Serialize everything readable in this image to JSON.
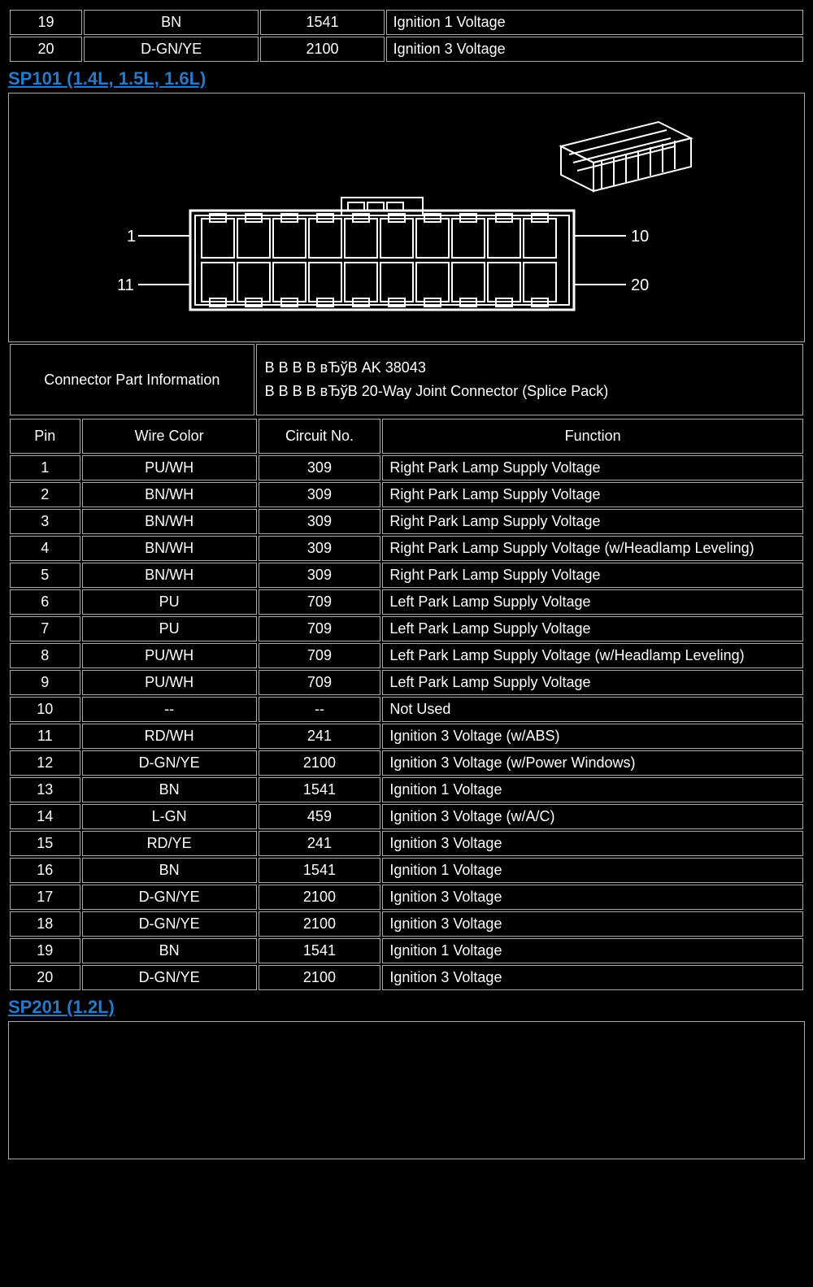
{
  "topRows": [
    {
      "pin": "19",
      "wire": "BN",
      "circ": "1541",
      "func": "Ignition 1 Voltage"
    },
    {
      "pin": "20",
      "wire": "D-GN/YE",
      "circ": "2100",
      "func": "Ignition 3 Voltage"
    }
  ],
  "heading1": "SP101 (1.4L, 1.5L, 1.6L)",
  "diagram": {
    "tl": "1",
    "tr": "10",
    "bl": "11",
    "br": "20"
  },
  "connInfo": {
    "label": "Connector Part Information",
    "line1": "В В В В вЂўВ  AK 38043",
    "line2": "В В В В вЂўВ  20-Way Joint Connector (Splice Pack)"
  },
  "headers": {
    "pin": "Pin",
    "wire": "Wire Color",
    "circ": "Circuit No.",
    "func": "Function"
  },
  "rows": [
    {
      "pin": "1",
      "wire": "PU/WH",
      "circ": "309",
      "func": "Right Park Lamp Supply Voltage"
    },
    {
      "pin": "2",
      "wire": "BN/WH",
      "circ": "309",
      "func": "Right Park Lamp Supply Voltage"
    },
    {
      "pin": "3",
      "wire": "BN/WH",
      "circ": "309",
      "func": "Right Park Lamp Supply Voltage"
    },
    {
      "pin": "4",
      "wire": "BN/WH",
      "circ": "309",
      "func": "Right Park Lamp Supply Voltage (w/Headlamp Leveling)"
    },
    {
      "pin": "5",
      "wire": "BN/WH",
      "circ": "309",
      "func": "Right Park Lamp Supply Voltage"
    },
    {
      "pin": "6",
      "wire": "PU",
      "circ": "709",
      "func": "Left Park Lamp Supply Voltage"
    },
    {
      "pin": "7",
      "wire": "PU",
      "circ": "709",
      "func": "Left Park Lamp Supply Voltage"
    },
    {
      "pin": "8",
      "wire": "PU/WH",
      "circ": "709",
      "func": "Left Park Lamp Supply Voltage (w/Headlamp Leveling)"
    },
    {
      "pin": "9",
      "wire": "PU/WH",
      "circ": "709",
      "func": "Left Park Lamp Supply Voltage"
    },
    {
      "pin": "10",
      "wire": "--",
      "circ": "--",
      "func": "Not Used"
    },
    {
      "pin": "11",
      "wire": "RD/WH",
      "circ": "241",
      "func": "Ignition 3 Voltage (w/ABS)"
    },
    {
      "pin": "12",
      "wire": "D-GN/YE",
      "circ": "2100",
      "func": "Ignition 3 Voltage (w/Power Windows)"
    },
    {
      "pin": "13",
      "wire": "BN",
      "circ": "1541",
      "func": "Ignition 1 Voltage"
    },
    {
      "pin": "14",
      "wire": "L-GN",
      "circ": "459",
      "func": "Ignition 3 Voltage (w/A/C)"
    },
    {
      "pin": "15",
      "wire": "RD/YE",
      "circ": "241",
      "func": "Ignition 3 Voltage"
    },
    {
      "pin": "16",
      "wire": "BN",
      "circ": "1541",
      "func": "Ignition 1 Voltage"
    },
    {
      "pin": "17",
      "wire": "D-GN/YE",
      "circ": "2100",
      "func": "Ignition 3 Voltage"
    },
    {
      "pin": "18",
      "wire": "D-GN/YE",
      "circ": "2100",
      "func": "Ignition 3 Voltage"
    },
    {
      "pin": "19",
      "wire": "BN",
      "circ": "1541",
      "func": "Ignition 1 Voltage"
    },
    {
      "pin": "20",
      "wire": "D-GN/YE",
      "circ": "2100",
      "func": "Ignition 3 Voltage"
    }
  ],
  "heading2": "SP201 (1.2L)"
}
